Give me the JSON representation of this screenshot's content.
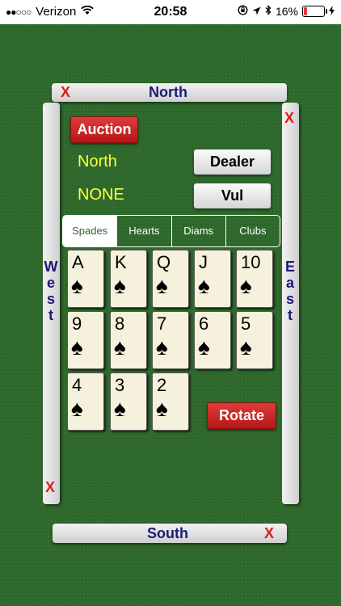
{
  "status_bar": {
    "carrier": "Verizon",
    "time": "20:58",
    "battery_percent": "16%",
    "signal_dots": "●●○○○",
    "wifi_icon": "wifi",
    "location_icon": "location-arrow",
    "bluetooth_icon": "bluetooth",
    "charging_icon": "bolt",
    "lock_icon": "rotation-lock",
    "battery_color": "#e43b3b"
  },
  "table": {
    "north_label": "North",
    "south_label": "South",
    "west_letters": [
      "W",
      "e",
      "s",
      "t"
    ],
    "east_letters": [
      "E",
      "a",
      "s",
      "t"
    ],
    "close_symbol": "X"
  },
  "controls": {
    "auction_label": "Auction",
    "dealer_value": "North",
    "dealer_button": "Dealer",
    "vul_value": "NONE",
    "vul_button": "Vul",
    "rotate_button": "Rotate"
  },
  "suit_tabs": [
    {
      "label": "Spades",
      "active": true
    },
    {
      "label": "Hearts",
      "active": false
    },
    {
      "label": "Diams",
      "active": false
    },
    {
      "label": "Clubs",
      "active": false
    }
  ],
  "cards": {
    "suit_symbol": "♠",
    "ranks": [
      "A",
      "K",
      "Q",
      "J",
      "10",
      "9",
      "8",
      "7",
      "6",
      "5",
      "4",
      "3",
      "2"
    ]
  },
  "colors": {
    "felt": "#2f6a2c",
    "label_blue": "#1a1a7a",
    "close_red": "#d62020",
    "yellow_text": "#ffff33",
    "red_button": "#c92323"
  }
}
